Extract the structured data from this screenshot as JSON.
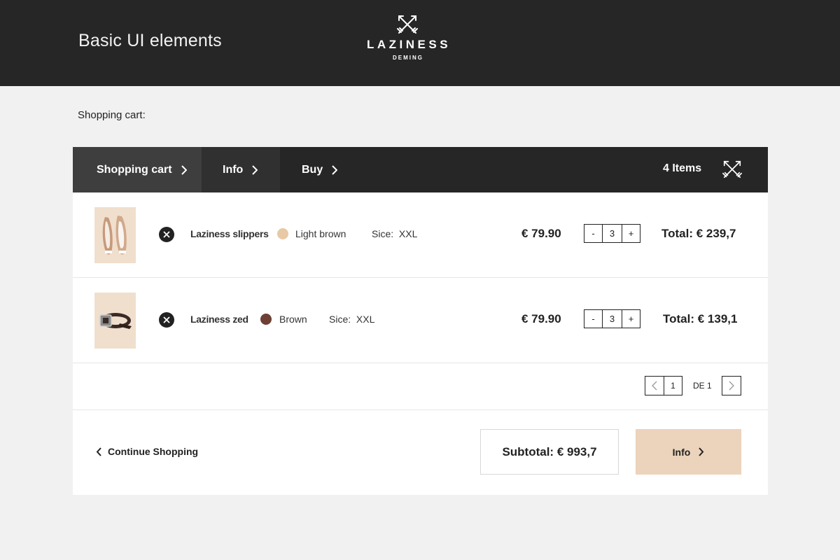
{
  "header": {
    "title": "Basic UI elements",
    "logo_brand": "LAZINESS",
    "logo_sub": "DEMING"
  },
  "cart_heading": "Shopping cart:",
  "steps": [
    {
      "label": "Shopping cart",
      "icon": "chevron-right-icon"
    },
    {
      "label": "Info",
      "icon": "chevron-right-icon"
    },
    {
      "label": "Buy",
      "icon": "chevron-right-icon"
    }
  ],
  "items_count": "4 Items",
  "items": [
    {
      "name": "Laziness slippers",
      "color_name": "Light brown",
      "color_hex": "#e8c9a6",
      "size_label": "Sice:",
      "size": "XXL",
      "price": "€ 79.90",
      "quantity": "3",
      "minus": "-",
      "plus": "+",
      "total": "Total: € 239,7"
    },
    {
      "name": "Laziness zed",
      "color_name": "Brown",
      "color_hex": "#6e3f34",
      "size_label": "Sice:",
      "size": "XXL",
      "price": "€ 79.90",
      "quantity": "3",
      "minus": "-",
      "plus": "+",
      "total": "Total: € 139,1"
    }
  ],
  "pagination": {
    "current": "1",
    "of_label": "DE 1"
  },
  "footer": {
    "continue_label": "Continue Shopping",
    "subtotal": "Subtotal: € 993,7",
    "next_label": "Info"
  },
  "colors": {
    "header_bg": "#262626",
    "accent": "#ecd3bc",
    "page_bg": "#f1f1f1"
  }
}
